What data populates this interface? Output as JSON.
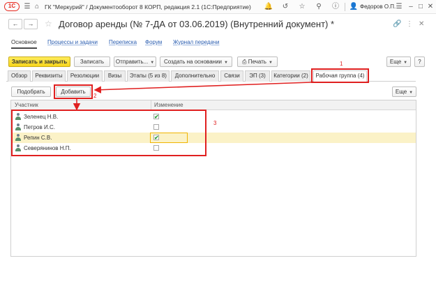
{
  "titlebar": {
    "logo": "1С",
    "title": "ГК \"Меркурий\" / Документооборот 8 КОРП, редакция 2.1  (1С:Предприятие)",
    "user": "Федоров О.П."
  },
  "nav": {
    "back": "←",
    "forward": "→",
    "star": "☆",
    "document_title": "Договор аренды (№ 7-ДА от 03.06.2019) (Внутренний документ) *"
  },
  "sections": {
    "main": "Основное",
    "links": [
      "Процессы и задачи",
      "Переписка",
      "Форум",
      "Журнал передачи"
    ]
  },
  "commands": {
    "save_close": "Записать и закрыть",
    "save": "Записать",
    "send": "Отправить...",
    "create_based": "Создать на основании",
    "print": "Печать",
    "more": "Еще"
  },
  "tabs": [
    "Обзор",
    "Реквизиты",
    "Резолюции",
    "Визы",
    "Этапы (5 из 8)",
    "Дополнительно",
    "Связи",
    "ЭП (3)",
    "Категории (2)",
    "Рабочая группа (4)"
  ],
  "workgroup": {
    "pick_button": "Подобрать",
    "add_button": "Добавить",
    "more_button": "Еще",
    "columns": {
      "participant": "Участник",
      "change": "Изменение"
    },
    "rows": [
      {
        "name": "Зеленец Н.В.",
        "change": true
      },
      {
        "name": "Петров И.С.",
        "change": false
      },
      {
        "name": "Репин С.В.",
        "change": true
      },
      {
        "name": "Северянинов Н.П.",
        "change": false
      }
    ]
  },
  "annotations": {
    "tab_marker": "1",
    "add_marker": "2",
    "table_marker": "3"
  },
  "colors": {
    "annotation": "#e02020",
    "primary_button": "#f7d51c",
    "selected_row": "#fbf2c7",
    "link": "#2a5db0"
  }
}
